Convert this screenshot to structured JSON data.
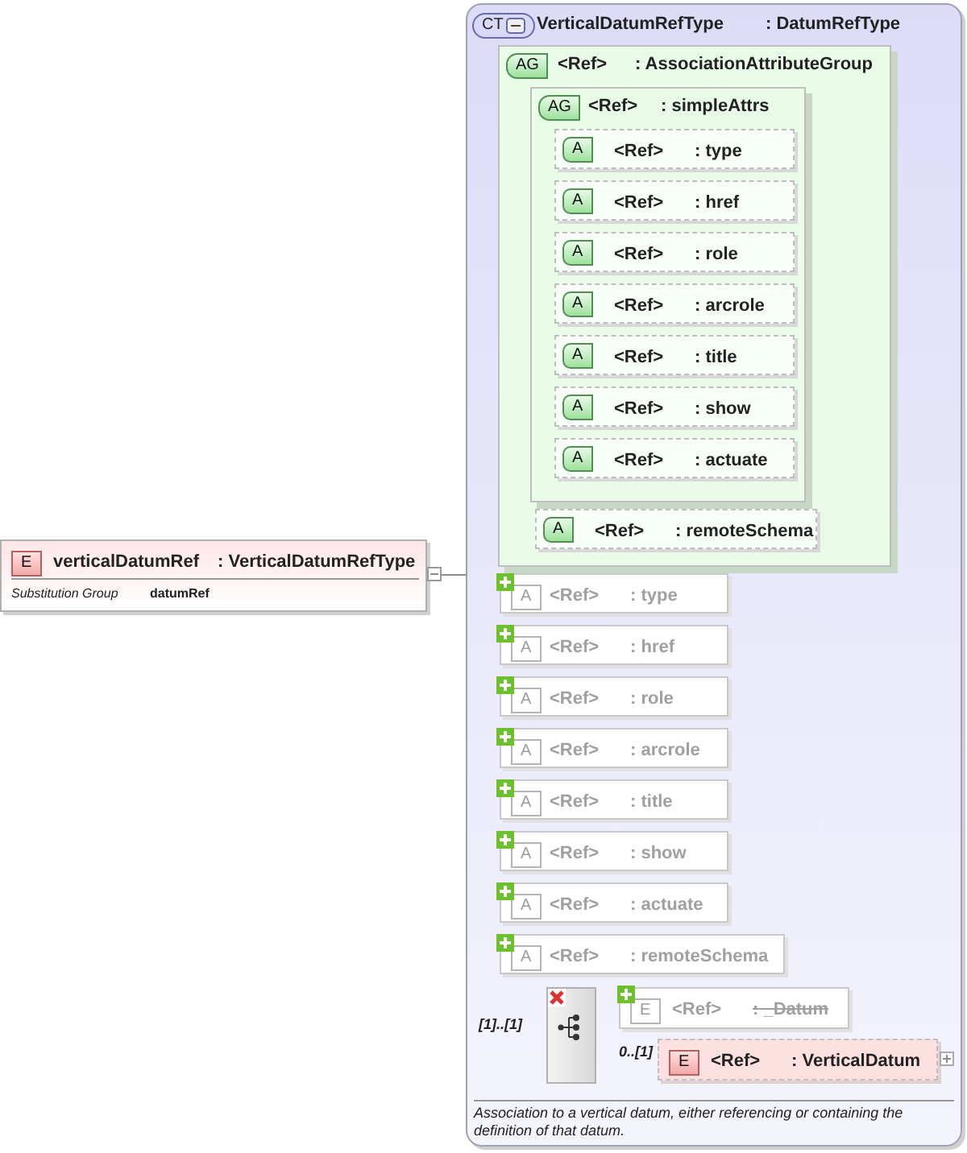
{
  "element": {
    "badge": "E",
    "name": "verticalDatumRef",
    "type": ": VerticalDatumRefType",
    "substitution_label": "Substitution Group",
    "substitution_value": "datumRef",
    "expanded": true
  },
  "complex_type": {
    "badge": "CT",
    "name": "VerticalDatumRefType",
    "base": ": DatumRefType",
    "description": "Association to a vertical datum, either referencing or containing the definition of that datum.",
    "attribute_group": {
      "badge": "AG",
      "ref": "<Ref>",
      "name": ": AssociationAttributeGroup",
      "children": [
        {
          "kind": "group",
          "badge": "AG",
          "ref": "<Ref>",
          "name": ": simpleAttrs",
          "children": [
            {
              "kind": "attribute",
              "badge": "A",
              "ref": "<Ref>",
              "name": ": type"
            },
            {
              "kind": "attribute",
              "badge": "A",
              "ref": "<Ref>",
              "name": ": href"
            },
            {
              "kind": "attribute",
              "badge": "A",
              "ref": "<Ref>",
              "name": ": role"
            },
            {
              "kind": "attribute",
              "badge": "A",
              "ref": "<Ref>",
              "name": ": arcrole"
            },
            {
              "kind": "attribute",
              "badge": "A",
              "ref": "<Ref>",
              "name": ": title"
            },
            {
              "kind": "attribute",
              "badge": "A",
              "ref": "<Ref>",
              "name": ": show"
            },
            {
              "kind": "attribute",
              "badge": "A",
              "ref": "<Ref>",
              "name": ": actuate"
            }
          ]
        },
        {
          "kind": "attribute",
          "badge": "A",
          "ref": "<Ref>",
          "name": ": remoteSchema"
        }
      ]
    },
    "inherited_attributes": [
      {
        "badge": "A",
        "ref": "<Ref>",
        "name": ": type"
      },
      {
        "badge": "A",
        "ref": "<Ref>",
        "name": ": href"
      },
      {
        "badge": "A",
        "ref": "<Ref>",
        "name": ": role"
      },
      {
        "badge": "A",
        "ref": "<Ref>",
        "name": ": arcrole"
      },
      {
        "badge": "A",
        "ref": "<Ref>",
        "name": ": title"
      },
      {
        "badge": "A",
        "ref": "<Ref>",
        "name": ": show"
      },
      {
        "badge": "A",
        "ref": "<Ref>",
        "name": ": actuate"
      },
      {
        "badge": "A",
        "ref": "<Ref>",
        "name": ": remoteSchema"
      }
    ],
    "choice": {
      "occurrence": "[1]..[1]",
      "elements": [
        {
          "badge": "E",
          "ref": "<Ref>",
          "name": ": _Datum",
          "abstract": true,
          "inherited": true
        },
        {
          "badge": "E",
          "ref": "<Ref>",
          "name": ": VerticalDatum",
          "occurrence": "0..[1]",
          "abstract": false,
          "inherited": false,
          "expanded": false
        }
      ]
    }
  }
}
